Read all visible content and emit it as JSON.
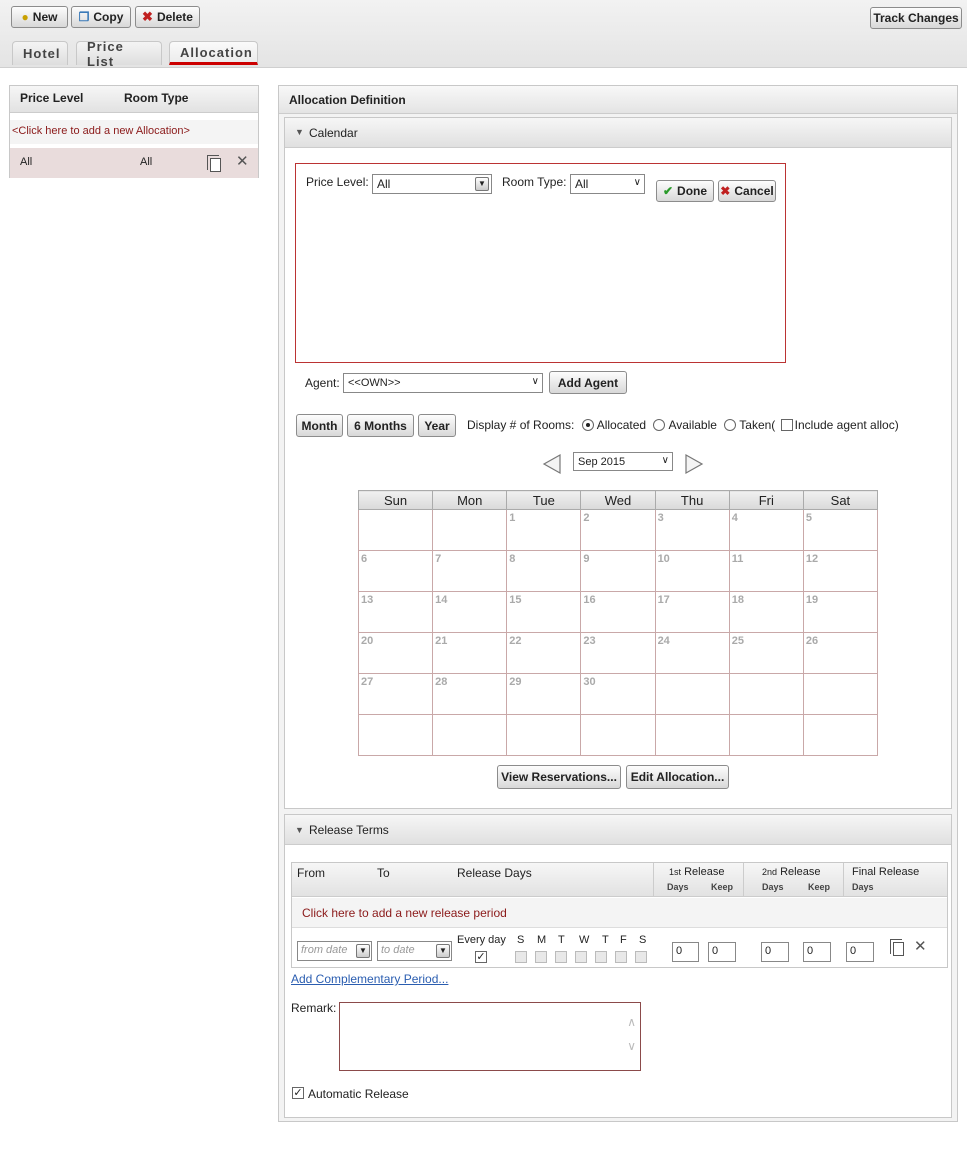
{
  "toolbar": {
    "new_label": "New",
    "copy_label": "Copy",
    "delete_label": "Delete",
    "track_changes_label": "Track Changes"
  },
  "tabs": [
    {
      "label": "Hotel"
    },
    {
      "label": "Price List"
    },
    {
      "label": "Allocation"
    }
  ],
  "left_panel": {
    "col_price_level": "Price Level",
    "col_room_type": "Room Type",
    "add_link": "<Click here to add a new Allocation>",
    "row": {
      "price_level": "All",
      "room_type": "All"
    }
  },
  "definition": {
    "title": "Allocation Definition",
    "calendar_section": "Calendar",
    "price_level_label": "Price Level:",
    "price_level_value": "All",
    "room_type_label": "Room Type:",
    "room_type_value": "All",
    "done_label": "Done",
    "cancel_label": "Cancel",
    "agent_label": "Agent:",
    "agent_value": "<<OWN>>",
    "add_agent_label": "Add Agent",
    "view_month": "Month",
    "view_6months": "6 Months",
    "view_year": "Year",
    "display_label": "Display # of Rooms:",
    "opt_allocated": "Allocated",
    "opt_available": "Available",
    "opt_taken": "Taken(",
    "opt_include_agent": "Include agent alloc)",
    "month_value": "Sep 2015",
    "weekdays": [
      "Sun",
      "Mon",
      "Tue",
      "Wed",
      "Thu",
      "Fri",
      "Sat"
    ],
    "weeks": [
      [
        "",
        "",
        "1",
        "2",
        "3",
        "4",
        "5"
      ],
      [
        "6",
        "7",
        "8",
        "9",
        "10",
        "11",
        "12"
      ],
      [
        "13",
        "14",
        "15",
        "16",
        "17",
        "18",
        "19"
      ],
      [
        "20",
        "21",
        "22",
        "23",
        "24",
        "25",
        "26"
      ],
      [
        "27",
        "28",
        "29",
        "30",
        "",
        "",
        ""
      ],
      [
        "",
        "",
        "",
        "",
        "",
        "",
        ""
      ]
    ],
    "view_reservations_label": "View Reservations...",
    "edit_allocation_label": "Edit Allocation..."
  },
  "release": {
    "section": "Release Terms",
    "col_from": "From",
    "col_to": "To",
    "col_release_days": "Release Days",
    "first_release": "1st Release",
    "first_release_sup": "1st",
    "first_release_rest": "Release",
    "second_release_sup": "2nd",
    "second_release_rest": "Release",
    "final_release": "Final Release",
    "days": "Days",
    "keep": "Keep",
    "add_link": "Click here to add a new release period",
    "from_placeholder": "from date",
    "to_placeholder": "to date",
    "every_day": "Every day",
    "day_letters": [
      "S",
      "M",
      "T",
      "W",
      "T",
      "F",
      "S"
    ],
    "values": [
      "0",
      "0",
      "0",
      "0",
      "0"
    ],
    "add_complementary": "Add Complementary Period...",
    "remark_label": "Remark:",
    "automatic_release": "Automatic Release"
  }
}
